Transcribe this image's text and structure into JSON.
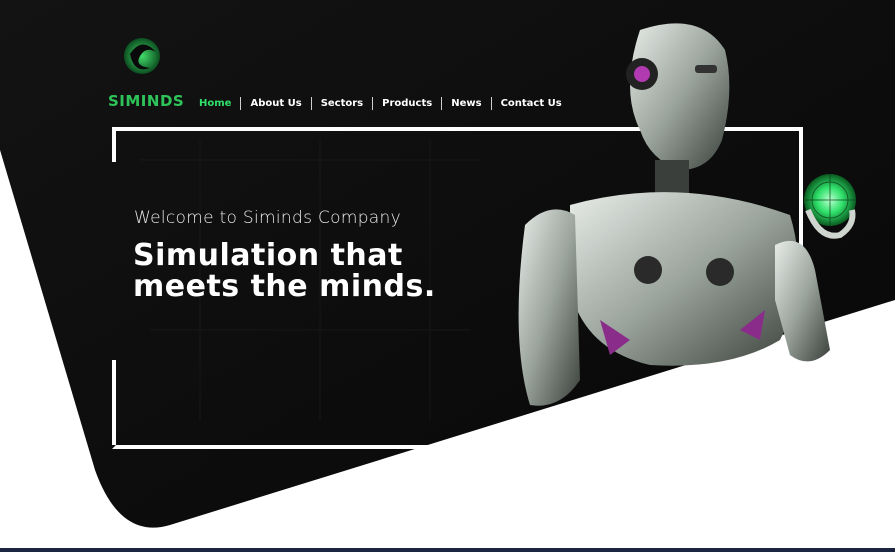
{
  "brand": {
    "name": "SIMINDS",
    "accent": "#2fe06a"
  },
  "nav": {
    "items": [
      {
        "label": "Home",
        "active": true
      },
      {
        "label": "About Us",
        "active": false
      },
      {
        "label": "Sectors",
        "active": false
      },
      {
        "label": "Products",
        "active": false
      },
      {
        "label": "News",
        "active": false
      },
      {
        "label": "Contact Us",
        "active": false
      }
    ]
  },
  "hero": {
    "welcome": "Welcome to Siminds Company",
    "headline_line1": "Simulation that",
    "headline_line2": "meets the minds."
  },
  "icons": {
    "logo": "spiral-globe-logo",
    "hero_image": "humanoid-robot-holding-green-sphere"
  }
}
